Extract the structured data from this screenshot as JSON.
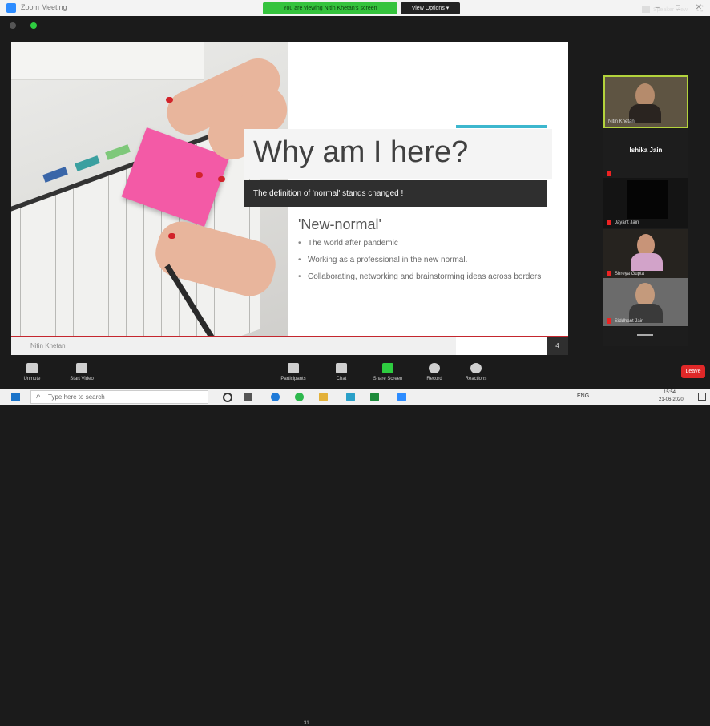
{
  "window": {
    "title": "Zoom Meeting"
  },
  "banner": {
    "share_status": "You are viewing Nitin Khetan's screen",
    "view_options": "View Options ▾"
  },
  "topbar": {
    "speaker_view": "Speaker View"
  },
  "slide": {
    "title": "Why am I here?",
    "subtitle": "The definition of 'normal' stands changed !",
    "heading": "'New-normal'",
    "bullets": [
      "The world after pandemic",
      "Working as a professional in the new normal.",
      "Collaborating, networking and brainstorming ideas across borders"
    ],
    "presenter": "Nitin Khetan",
    "page_number": "4"
  },
  "participants": [
    {
      "name": "Nitin Khetan",
      "muted": false
    },
    {
      "name": "Ishika Jain",
      "muted": true
    },
    {
      "name": "Jayant Jain",
      "muted": true
    },
    {
      "name": "Shreya Gupta",
      "muted": true
    },
    {
      "name": "Siddhant Jain",
      "muted": true
    }
  ],
  "controls": {
    "unmute": "Unmute",
    "start_video": "Start Video",
    "participants": "Participants",
    "participants_count": "31",
    "chat": "Chat",
    "share_screen": "Share Screen",
    "record": "Record",
    "reactions": "Reactions",
    "end": "Leave"
  },
  "taskbar": {
    "search_placeholder": "Type here to search",
    "tray": "ENG",
    "time": "15:54",
    "date": "21-06-2020"
  },
  "colors": {
    "accent": "#3db7ce",
    "share_green": "#35c33d",
    "end_red": "#e02828",
    "slide_dark": "#2f2f2f"
  }
}
